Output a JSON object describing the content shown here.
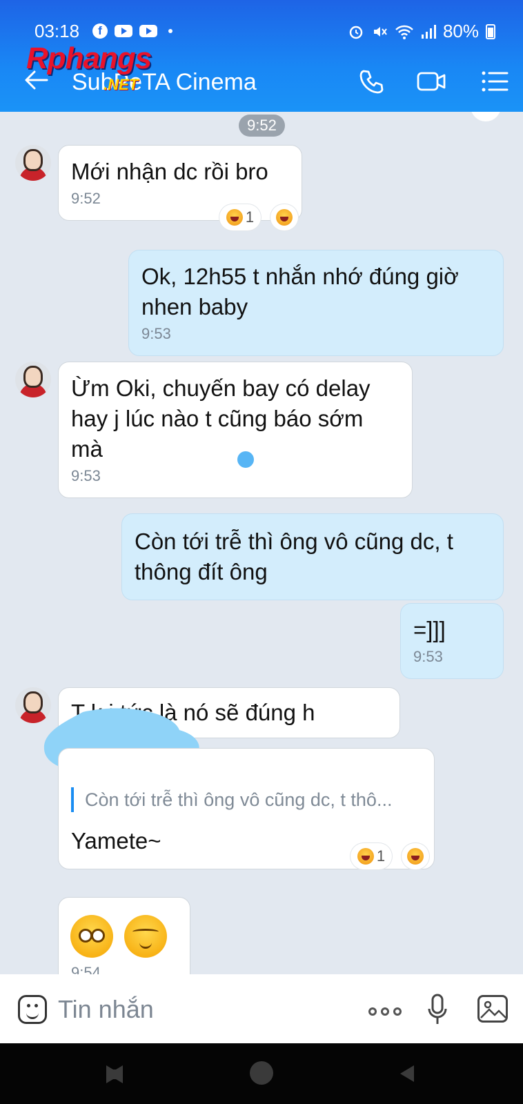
{
  "status_bar": {
    "time": "03:18",
    "battery": "80%"
  },
  "watermark": {
    "main": "Rphangs",
    "sub": ".NET"
  },
  "header": {
    "title": "SubPeTA Cinema"
  },
  "icons": {
    "back": "arrow-left-icon",
    "call": "phone-icon",
    "video": "video-camera-icon",
    "menu": "list-menu-icon",
    "emoji": "smiley-icon",
    "more": "more-dots-icon",
    "mic": "microphone-icon",
    "image": "image-icon",
    "reaction": "laughing-face-icon"
  },
  "colors": {
    "header": "#1a86f2",
    "incoming": "#ffffff",
    "outgoing": "#d3edfc",
    "chat_bg": "#e2e8f0"
  },
  "chat": {
    "date_chip": "9:52",
    "messages": [
      {
        "dir": "in",
        "text": "Mới nhận dc rồi bro",
        "time": "9:52",
        "reaction_count": "1"
      },
      {
        "dir": "out",
        "text": "Ok, 12h55 t nhắn nhớ đúng giờ nhen baby",
        "time": "9:53"
      },
      {
        "dir": "in",
        "text": "Ừm Oki, chuyến bay có delay hay j lúc nào t cũng báo sớm mà",
        "time": "9:53"
      },
      {
        "dir": "out",
        "text": "Còn tới trễ thì ông vô cũng dc, t thông đít ông"
      },
      {
        "dir": "out",
        "text": "=]]]",
        "time": "9:53"
      },
      {
        "dir": "in",
        "text": "T k    i tức là nó sẽ đúng h"
      },
      {
        "dir": "in",
        "quote": "Còn tới trễ thì ông vô cũng dc, t thô...",
        "text": "Yamete~",
        "reaction_count": "1"
      },
      {
        "dir": "in",
        "emojis": [
          "worried-face-icon",
          "blushing-face-icon"
        ],
        "time": "9:54"
      }
    ]
  },
  "input": {
    "placeholder": "Tin nhắn"
  }
}
